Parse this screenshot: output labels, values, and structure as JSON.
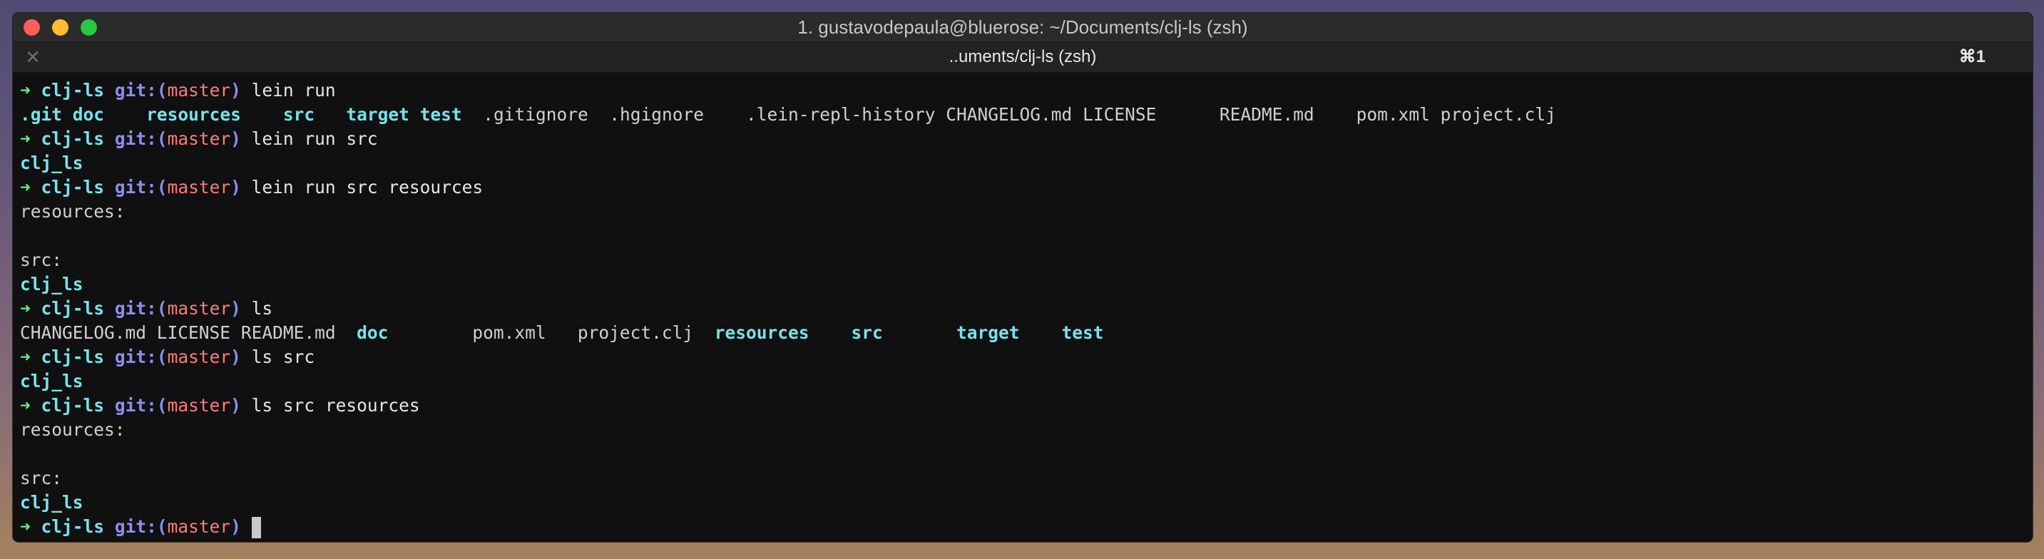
{
  "window": {
    "title": "1. gustavodepaula@bluerose: ~/Documents/clj-ls (zsh)",
    "tab_title": "..uments/clj-ls (zsh)",
    "tab_shortcut": "⌘1",
    "tab_close_glyph": "✕"
  },
  "prompt": {
    "arrow": "➜",
    "dir": "clj-ls",
    "git_open": "git:(",
    "branch": "master",
    "git_close": ")"
  },
  "lines": [
    {
      "type": "prompt",
      "cmd": "lein run"
    },
    {
      "type": "listing",
      "items": [
        {
          "text": ".git",
          "kind": "folder",
          "col": 0
        },
        {
          "text": "doc",
          "kind": "folder",
          "col": 5
        },
        {
          "text": "resources",
          "kind": "folder",
          "col": 12
        },
        {
          "text": "src",
          "kind": "folder",
          "col": 25
        },
        {
          "text": "target",
          "kind": "folder",
          "col": 31
        },
        {
          "text": "test",
          "kind": "folder",
          "col": 38
        },
        {
          "text": ".gitignore",
          "kind": "file",
          "col": 44
        },
        {
          "text": ".hgignore",
          "kind": "file",
          "col": 56
        },
        {
          "text": ".lein-repl-history",
          "kind": "file",
          "col": 69
        },
        {
          "text": "CHANGELOG.md",
          "kind": "file",
          "col": 88
        },
        {
          "text": "LICENSE",
          "kind": "file",
          "col": 101
        },
        {
          "text": "README.md",
          "kind": "file",
          "col": 114
        },
        {
          "text": "pom.xml",
          "kind": "file",
          "col": 127
        },
        {
          "text": "project.clj",
          "kind": "file",
          "col": 135
        }
      ]
    },
    {
      "type": "prompt",
      "cmd": "lein run src"
    },
    {
      "type": "listing",
      "items": [
        {
          "text": "clj_ls",
          "kind": "folder",
          "col": 0
        }
      ]
    },
    {
      "type": "prompt",
      "cmd": "lein run src resources"
    },
    {
      "type": "text",
      "text": "resources:"
    },
    {
      "type": "text",
      "text": ""
    },
    {
      "type": "text",
      "text": "src:"
    },
    {
      "type": "listing",
      "items": [
        {
          "text": "clj_ls",
          "kind": "folder",
          "col": 0
        }
      ]
    },
    {
      "type": "prompt",
      "cmd": "ls"
    },
    {
      "type": "listing",
      "items": [
        {
          "text": "CHANGELOG.md",
          "kind": "file",
          "col": 0
        },
        {
          "text": "LICENSE",
          "kind": "file",
          "col": 13
        },
        {
          "text": "README.md",
          "kind": "file",
          "col": 21
        },
        {
          "text": "doc",
          "kind": "folder",
          "col": 32
        },
        {
          "text": "pom.xml",
          "kind": "file",
          "col": 43
        },
        {
          "text": "project.clj",
          "kind": "file",
          "col": 53
        },
        {
          "text": "resources",
          "kind": "folder",
          "col": 66
        },
        {
          "text": "src",
          "kind": "folder",
          "col": 79
        },
        {
          "text": "target",
          "kind": "folder",
          "col": 89
        },
        {
          "text": "test",
          "kind": "folder",
          "col": 99
        }
      ]
    },
    {
      "type": "prompt",
      "cmd": "ls src"
    },
    {
      "type": "listing",
      "items": [
        {
          "text": "clj_ls",
          "kind": "folder",
          "col": 0
        }
      ]
    },
    {
      "type": "prompt",
      "cmd": "ls src resources"
    },
    {
      "type": "text",
      "text": "resources:"
    },
    {
      "type": "text",
      "text": ""
    },
    {
      "type": "text",
      "text": "src:"
    },
    {
      "type": "listing",
      "items": [
        {
          "text": "clj_ls",
          "kind": "folder",
          "col": 0
        }
      ]
    },
    {
      "type": "prompt",
      "cmd": "",
      "cursor": true
    }
  ],
  "colors": {
    "arrow": "#5ff28a",
    "dir": "#76e3ec",
    "git": "#8b8ff0",
    "branch": "#ff7a7a",
    "folder": "#76e3ec",
    "text": "#d0d0d0",
    "background": "#101010"
  },
  "icons": {
    "close_light": "close-traffic-light",
    "minimize_light": "minimize-traffic-light",
    "zoom_light": "zoom-traffic-light",
    "tab_close": "close-icon"
  }
}
